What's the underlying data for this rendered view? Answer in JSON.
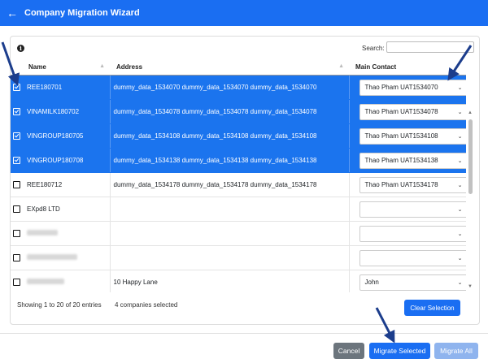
{
  "header": {
    "back_icon": "arrow-left-icon",
    "title": "Company Migration Wizard"
  },
  "search": {
    "label": "Search:",
    "value": ""
  },
  "table": {
    "columns": [
      "Name",
      "Address",
      "Main Contact"
    ],
    "rows": [
      {
        "selected": true,
        "name": "REE180701",
        "address": "dummy_data_1534070 dummy_data_1534070 dummy_data_1534070",
        "contact": "Thao Pham UAT1534070"
      },
      {
        "selected": true,
        "name": "VINAMILK180702",
        "address": "dummy_data_1534078 dummy_data_1534078 dummy_data_1534078",
        "contact": "Thao Pham UAT1534078"
      },
      {
        "selected": true,
        "name": "VINGROUP180705",
        "address": "dummy_data_1534108 dummy_data_1534108 dummy_data_1534108",
        "contact": "Thao Pham UAT1534108"
      },
      {
        "selected": true,
        "name": "VINGROUP180708",
        "address": "dummy_data_1534138 dummy_data_1534138 dummy_data_1534138",
        "contact": "Thao Pham UAT1534138"
      },
      {
        "selected": false,
        "name": "REE180712",
        "address": "dummy_data_1534178 dummy_data_1534178 dummy_data_1534178",
        "contact": "Thao Pham UAT1534178"
      },
      {
        "selected": false,
        "name": "EXpd8 LTD",
        "address": "",
        "contact": ""
      },
      {
        "selected": false,
        "name": "",
        "address": "",
        "contact": ""
      },
      {
        "selected": false,
        "name": "",
        "address": "",
        "contact": ""
      },
      {
        "selected": false,
        "name": "",
        "address": "10 Happy Lane",
        "contact": "John"
      }
    ]
  },
  "footer": {
    "showing": "Showing 1 to 20 of 20 entries",
    "selected_count": "4 companies selected",
    "clear_selection": "Clear Selection"
  },
  "actions": {
    "cancel": "Cancel",
    "migrate_selected": "Migrate Selected",
    "migrate_all": "Migrate All"
  },
  "colors": {
    "primary": "#1a6ef2",
    "selected_row": "#1b74ee",
    "cancel": "#6c757d",
    "disabled_primary": "#8fb4ee",
    "annotation_arrow": "#1c3d8c"
  }
}
